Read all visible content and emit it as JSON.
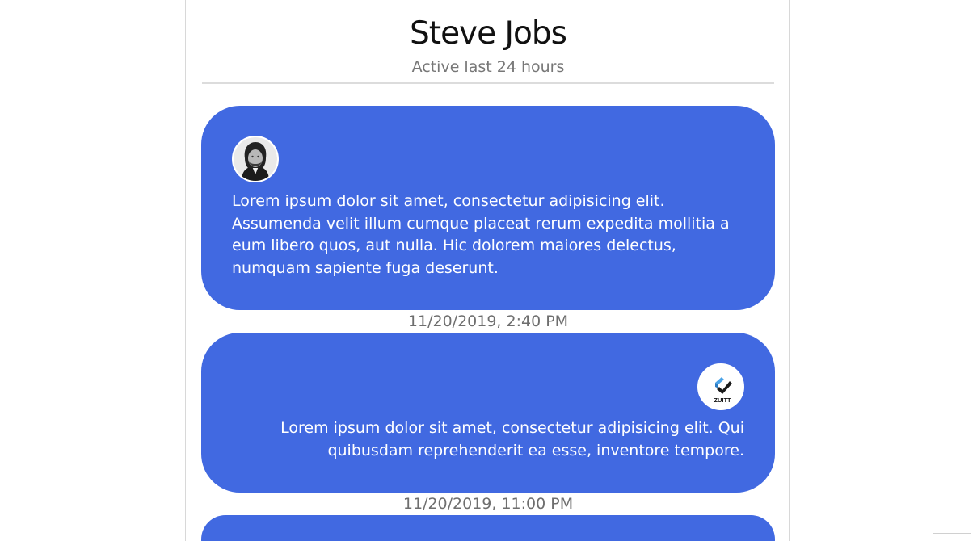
{
  "header": {
    "contact_name": "Steve Jobs",
    "status": "Active last 24 hours"
  },
  "messages": [
    {
      "sender_avatar": "steve-jobs-photo",
      "text": "Lorem ipsum dolor sit amet, consectetur adipisicing elit. Assumenda velit illum cumque placeat rerum expedita mollitia a eum libero quos, aut nulla. Hic dolorem maiores delectus, numquam sapiente fuga deserunt.",
      "timestamp": "11/20/2019, 2:40 PM",
      "align": "left"
    },
    {
      "sender_avatar": "zuitt-logo",
      "avatar_label": "ZUITT",
      "text": "Lorem ipsum dolor sit amet, consectetur adipisicing elit. Qui quibusdam reprehenderit ea esse, inventore tempore.",
      "timestamp": "11/20/2019, 11:00 PM",
      "align": "right"
    },
    {
      "text": "",
      "align": "left"
    }
  ],
  "colors": {
    "bubble": "#4169e1",
    "timestamp": "#6e6e6e",
    "status": "#777777",
    "divider": "#dcdcdc"
  }
}
